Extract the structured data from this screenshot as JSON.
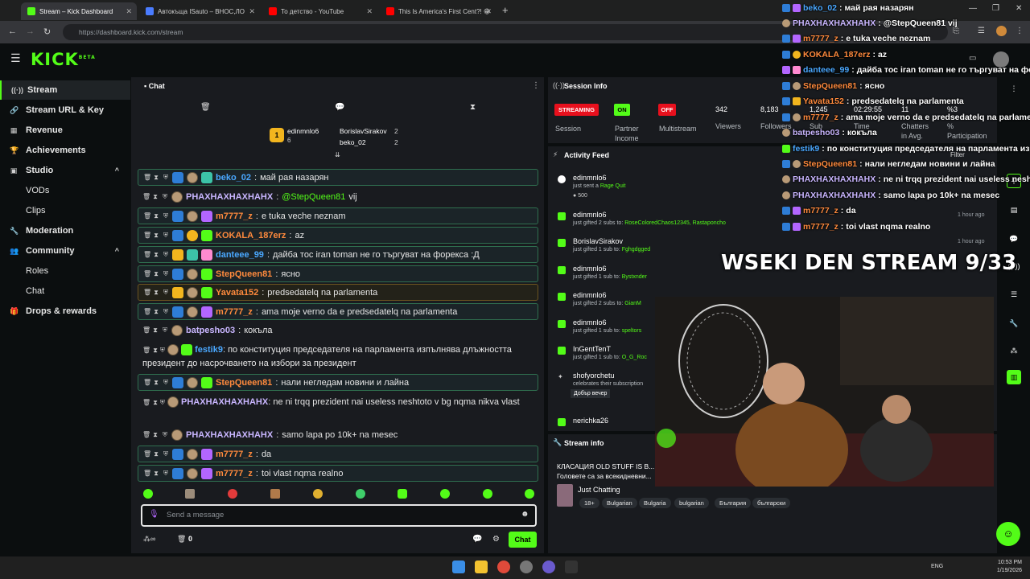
{
  "browser": {
    "tabs": [
      {
        "title": "Stream – Kick Dashboard",
        "active": true,
        "favicon_color": "#53fc18"
      },
      {
        "title": "Автокъща ISauto – ВНОС,ЛО",
        "active": false,
        "favicon_color": "#4a7cff"
      },
      {
        "title": "То детство - YouTube",
        "active": false,
        "favicon_color": "#ff0000"
      },
      {
        "title": "This Is America's First Cent?! 😁",
        "active": false,
        "favicon_color": "#ff0000"
      }
    ],
    "new_tab": "+",
    "url": "https://dashboard.kick.com/stream"
  },
  "header": {
    "logo": "KICK",
    "logo_sup": "BETA"
  },
  "sidebar": {
    "items": [
      {
        "label": "Stream",
        "icon": "stream-icon",
        "active": true,
        "sub": false
      },
      {
        "label": "Stream URL & Key",
        "icon": "link-icon",
        "sub": false
      },
      {
        "label": "Revenue",
        "icon": "revenue-icon",
        "sub": false
      },
      {
        "label": "Achievements",
        "icon": "trophy-icon",
        "sub": false
      },
      {
        "label": "Studio",
        "icon": "studio-icon",
        "sub": false,
        "chevron": "^"
      },
      {
        "label": "VODs",
        "sub": true
      },
      {
        "label": "Clips",
        "sub": true
      },
      {
        "label": "Moderation",
        "icon": "wrench-icon",
        "sub": false
      },
      {
        "label": "Community",
        "icon": "community-icon",
        "sub": false,
        "chevron": "^"
      },
      {
        "label": "Roles",
        "sub": true
      },
      {
        "label": "Chat",
        "sub": true
      },
      {
        "label": "Drops & rewards",
        "icon": "gift-icon",
        "sub": false
      }
    ]
  },
  "chat": {
    "title": "Chat",
    "leaderboard": {
      "first": {
        "rank": "1",
        "name": "edinmnlo6",
        "count": "6"
      },
      "second": {
        "name": "BorislavSirakov",
        "count": "2"
      },
      "third": {
        "name": "beko_02",
        "count": "2"
      }
    },
    "messages": [
      {
        "user": "beko_02",
        "text": "май рая назарян",
        "color": "#4aa8ff",
        "style": "hl"
      },
      {
        "user": "PHAXHAXHAXHAHX",
        "text": "@StepQueen81 vij",
        "mention": "@StepQueen81",
        "mtext": "vij",
        "color": "#c9b6ff",
        "style": "plain"
      },
      {
        "user": "m7777_z",
        "text": "e tuka veche neznam",
        "color": "#ff8a3d",
        "style": "hl"
      },
      {
        "user": "KOKALA_187erz",
        "text": "az",
        "color": "#ff8a3d",
        "style": "hl"
      },
      {
        "user": "danteee_99",
        "text": "дайба тос iran toman не го търгуват на форекса :Д",
        "color": "#4aa8ff",
        "style": "hl"
      },
      {
        "user": "StepQueen81",
        "text": "ясно",
        "color": "#ff8a3d",
        "style": "hl"
      },
      {
        "user": "Yavata152",
        "text": "predsedatelq na parlamenta",
        "color": "#ff8a3d",
        "style": "gold"
      },
      {
        "user": "m7777_z",
        "text": "ama moje verno da e predsedatelq na parlamenta",
        "color": "#ff8a3d",
        "style": "hl"
      },
      {
        "user": "batpesho03",
        "text": "кокъла",
        "color": "#c9b6ff",
        "style": "plain"
      },
      {
        "user": "festik9",
        "text": "по конституция председателя на парламента изпълнява длъжността президент до насрочването на избори за президент",
        "color": "#4aa8ff",
        "style": "plain"
      },
      {
        "user": "StepQueen81",
        "text": "нали негледам новини и лайна",
        "color": "#ff8a3d",
        "style": "hl"
      },
      {
        "user": "PHAXHAXHAXHAHX",
        "text": "ne ni trqq prezident nai useless neshtoto v bg nqma nikva vlast",
        "color": "#c9b6ff",
        "style": "plain"
      },
      {
        "user": "PHAXHAXHAXHAHX",
        "text": "samo lapa po 10k+ na mesec",
        "color": "#c9b6ff",
        "style": "plain"
      },
      {
        "user": "m7777_z",
        "text": "da",
        "color": "#ff8a3d",
        "style": "hl"
      },
      {
        "user": "m7777_z",
        "text": "toi vlast nqma realno",
        "color": "#ff8a3d",
        "style": "hl"
      }
    ],
    "input_placeholder": "Send a message",
    "footer_count": "0",
    "send_label": "Chat"
  },
  "session": {
    "title": "Session Info",
    "streaming_badge": "STREAMING",
    "on_badge": "ON",
    "off_badge": "OFF",
    "session_label": "Session",
    "partner_label": "Partner Income",
    "multistream_label": "Multistream",
    "viewers_value": "342",
    "viewers_label": "Viewers",
    "followers_value": "8,183",
    "followers_label": "Followers",
    "subs_value": "1,245",
    "subs_label": "Sub",
    "time_value": "02:29:55",
    "time_label": "Time",
    "chatters_value": "11",
    "chatters_label": "Chatters in Avg.",
    "participation_value": "%3",
    "participation_label": "% Participation"
  },
  "activity": {
    "title": "Activity Feed",
    "filter": "Filter",
    "items": [
      {
        "name": "edinmnlo6",
        "desc": "just sent a",
        "extra": "Rage Quit",
        "amount": "500",
        "time": ""
      },
      {
        "name": "edinmnlo6",
        "desc": "just gifted 2 subs to:",
        "extra": "RoseColoredChaos12345, Rastaponcho",
        "time": "1 hour ago"
      },
      {
        "name": "BorislavSirakov",
        "desc": "just gifted 1 sub to:",
        "extra": "Fghgdgged",
        "time": "1 hour ago"
      },
      {
        "name": "edinmnlo6",
        "desc": "just gifted 1 sub to:",
        "extra": "Bystxnder",
        "time": ""
      },
      {
        "name": "edinmnlo6",
        "desc": "just gifted 2 subs to:",
        "extra": "GianM",
        "time": ""
      },
      {
        "name": "edinmnlo6",
        "desc": "just gifted 1 sub to:",
        "extra": "speltors",
        "time": ""
      },
      {
        "name": "InGentTenT",
        "desc": "just gifted 1 sub to:",
        "extra": "O_G_Roc",
        "time": ""
      },
      {
        "name": "shofyorchetu",
        "desc": "celebrates their subscription",
        "extra": "Добър вечер",
        "time": ""
      },
      {
        "name": "nerichka26",
        "desc": "",
        "extra": "",
        "time": ""
      }
    ]
  },
  "stream_info": {
    "title": "Stream info",
    "stream_title": "КЛАСАЦИЯ OLD STUFF IS B...",
    "stream_sub": "Головете са за всекидневни...",
    "category": "Just Chatting",
    "tags": [
      "18+",
      "Bulgarian",
      "Bulgaria",
      "bulgarian",
      "България",
      "български"
    ]
  },
  "overlay": {
    "title": "WSEKI DEN STREAM 9/33",
    "chat": [
      {
        "user": "beko_02",
        "text": "май рая назарян",
        "color": "#4aa8ff"
      },
      {
        "user": "PHAXHAXHAXHAHX",
        "text": "@StepQueen81 vij",
        "color": "#c9b6ff"
      },
      {
        "user": "m7777_z",
        "text": "e tuka veche neznam",
        "color": "#ff8a3d"
      },
      {
        "user": "KOKALA_187erz",
        "text": "az",
        "color": "#ff8a3d"
      },
      {
        "user": "danteee_99",
        "text": "дайба тос iran toman не го търгуват на форе",
        "color": "#4aa8ff"
      },
      {
        "user": "StepQueen81",
        "text": "ясно",
        "color": "#ff8a3d"
      },
      {
        "user": "Yavata152",
        "text": "predsedatelq na parlamenta",
        "color": "#ff8a3d"
      },
      {
        "user": "m7777_z",
        "text": "ama moje verno da e predsedatelq na parlame",
        "color": "#ff8a3d"
      },
      {
        "user": "batpesho03",
        "text": "кокъла",
        "color": "#c9b6ff"
      },
      {
        "user": "festik9",
        "text": "по конституция председателя на парламента из",
        "color": "#4aa8ff"
      },
      {
        "user": "StepQueen81",
        "text": "нали негледам новини и лайна",
        "color": "#ff8a3d"
      },
      {
        "user": "PHAXHAXHAXHAHX",
        "text": "ne ni trqq prezident nai useless neshto",
        "color": "#c9b6ff"
      },
      {
        "user": "PHAXHAXHAXHAHX",
        "text": "samo lapa po 10k+ na mesec",
        "color": "#c9b6ff"
      },
      {
        "user": "m7777_z",
        "text": "da",
        "color": "#ff8a3d"
      },
      {
        "user": "m7777_z",
        "text": "toi vlast nqma realno",
        "color": "#ff8a3d"
      }
    ]
  },
  "taskbar": {
    "lang": "ENG",
    "time": "10:53 PM",
    "date": "1/19/2026"
  },
  "colors": {
    "accent": "#53fc18",
    "panel": "#191b1f",
    "bg": "#0b0e0f",
    "streaming_red": "#e8101d"
  }
}
